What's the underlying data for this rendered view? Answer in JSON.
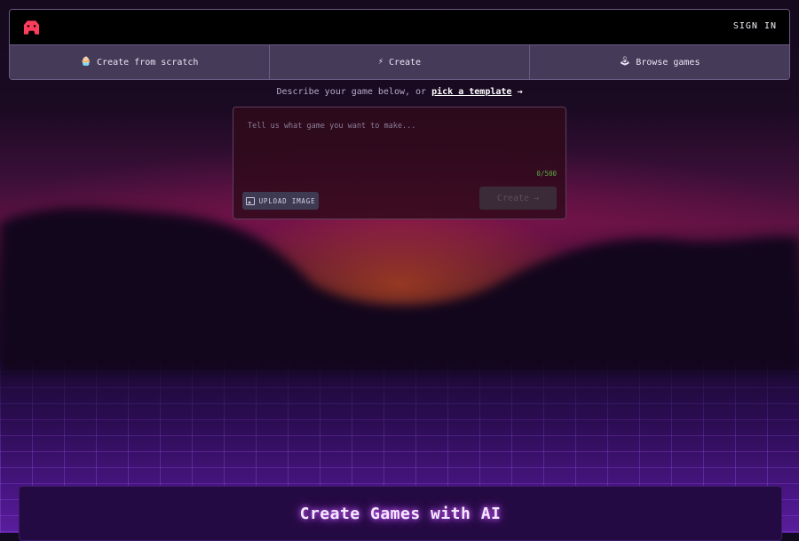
{
  "header": {
    "sign_in_label": "SIGN IN",
    "logo_icon": "gamepad-logo-icon",
    "accent_color": "#ff4d6d"
  },
  "tabs": [
    {
      "label": "Create from scratch",
      "icon": "cake-icon"
    },
    {
      "label": "Create",
      "icon": "lightning-icon"
    },
    {
      "label": "Browse games",
      "icon": "joystick-icon"
    }
  ],
  "hint": {
    "prefix": "Describe your game below, or",
    "link": "pick a template",
    "arrow": "→"
  },
  "prompt": {
    "placeholder": "Tell us what game you want to make...",
    "value": "",
    "counter": "0/500",
    "upload_label": "UPLOAD IMAGE",
    "create_label": "Create",
    "create_arrow": "→"
  },
  "hero": {
    "title": "Create Games with AI"
  }
}
